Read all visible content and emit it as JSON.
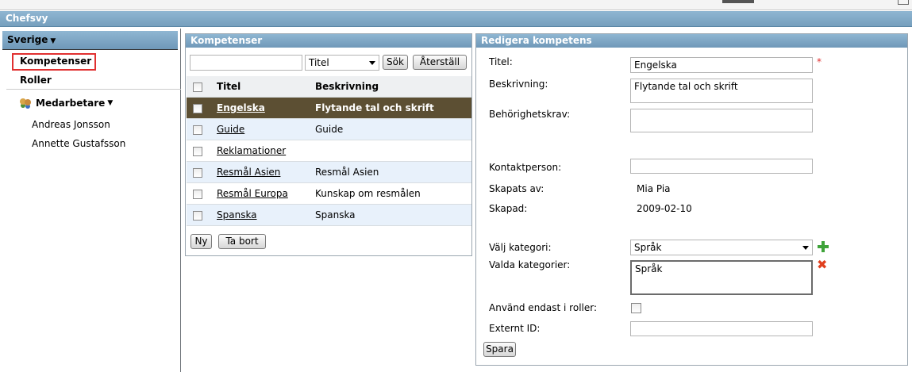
{
  "app": {
    "title": "Chefsvy"
  },
  "nav": {
    "region": "Sverige",
    "items": [
      {
        "label": "Kompetenser",
        "active": true
      },
      {
        "label": "Roller",
        "active": false
      }
    ],
    "team_label": "Medarbetare",
    "people": [
      "Andreas Jonsson",
      "Annette Gustafsson"
    ]
  },
  "list_panel": {
    "title": "Kompetenser",
    "search_value": "",
    "filter_selected": "Titel",
    "search_button": "Sök",
    "reset_button": "Återställ",
    "columns": [
      "Titel",
      "Beskrivning"
    ],
    "rows": [
      {
        "title": "Engelska",
        "description": "Flytande tal och skrift",
        "selected": true
      },
      {
        "title": "Guide",
        "description": "Guide",
        "selected": false
      },
      {
        "title": "Reklamationer",
        "description": "",
        "selected": false
      },
      {
        "title": "Resmål Asien",
        "description": "Resmål Asien",
        "selected": false
      },
      {
        "title": "Resmål Europa",
        "description": "Kunskap om resmålen",
        "selected": false
      },
      {
        "title": "Spanska",
        "description": "Spanska",
        "selected": false
      }
    ],
    "new_button": "Ny",
    "delete_button": "Ta bort"
  },
  "edit_panel": {
    "title": "Redigera kompetens",
    "labels": {
      "title": "Titel:",
      "description": "Beskrivning:",
      "requirements": "Behörighetskrav:",
      "contact": "Kontaktperson:",
      "created_by": "Skapats av:",
      "created": "Skapad:",
      "category": "Välj kategori:",
      "selected_categories": "Valda kategorier:",
      "roles_only": "Använd endast i roller:",
      "external_id": "Externt ID:"
    },
    "values": {
      "title": "Engelska",
      "description": "Flytande tal och skrift",
      "requirements": "",
      "contact": "",
      "created_by": "Mia Pia",
      "created": "2009-02-10",
      "category": "Språk",
      "selected_categories": "Språk",
      "roles_only": false,
      "external_id": ""
    },
    "required_mark": "*",
    "save_button": "Spara"
  },
  "colors": {
    "header_blue": "#7fa9c8",
    "selected_row": "#5c4f33",
    "alt_row": "#e8f1fb",
    "required": "#e03030",
    "add": "#3fa33a",
    "remove": "#e0401e"
  }
}
